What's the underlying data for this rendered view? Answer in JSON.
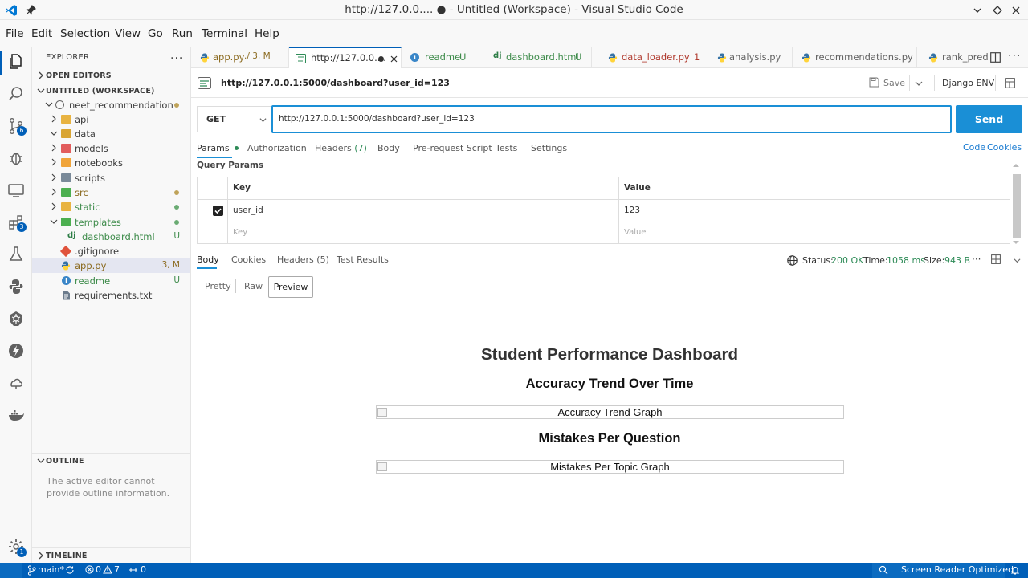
{
  "window": {
    "title": "http://127.0.0.... ● - Untitled (Workspace) - Visual Studio Code"
  },
  "menu": [
    "File",
    "Edit",
    "Selection",
    "View",
    "Go",
    "Run",
    "Terminal",
    "Help"
  ],
  "activity_badges": {
    "source_control": "6",
    "extensions": "3",
    "accounts": "1"
  },
  "sidebar": {
    "explorer_label": "EXPLORER",
    "open_editors": "OPEN EDITORS",
    "workspace": "UNTITLED (WORKSPACE)",
    "root": "neet_recommendation",
    "items": [
      {
        "label": "api",
        "status": ""
      },
      {
        "label": "data",
        "status": ""
      },
      {
        "label": "models",
        "status": ""
      },
      {
        "label": "notebooks",
        "status": ""
      },
      {
        "label": "scripts",
        "status": ""
      },
      {
        "label": "src",
        "status": "dot"
      },
      {
        "label": "static",
        "status": "dot"
      },
      {
        "label": "templates",
        "status": "dot"
      },
      {
        "label": "dashboard.html",
        "status": "U"
      },
      {
        "label": ".gitignore",
        "status": ""
      },
      {
        "label": "app.py",
        "status": "3, M"
      },
      {
        "label": "readme",
        "status": "U"
      },
      {
        "label": "requirements.txt",
        "status": ""
      }
    ],
    "outline_label": "OUTLINE",
    "outline_msg": "The active editor cannot provide outline information.",
    "timeline_label": "TIMELINE"
  },
  "tabs": [
    {
      "label": "app.py",
      "suffix": "./ 3, M"
    },
    {
      "label": "http://127.0.0....",
      "suffix": ""
    },
    {
      "label": "readme",
      "suffix": "U"
    },
    {
      "label": "dashboard.html",
      "suffix": "U"
    },
    {
      "label": "data_loader.py",
      "suffix": "1"
    },
    {
      "label": "analysis.py",
      "suffix": ""
    },
    {
      "label": "recommendations.py",
      "suffix": ""
    },
    {
      "label": "rank_predi",
      "suffix": ""
    }
  ],
  "request": {
    "title": "http://127.0.0.1:5000/dashboard?user_id=123",
    "save": "Save",
    "env": "Django ENV",
    "method": "GET",
    "url": "http://127.0.0.1:5000/dashboard?user_id=123",
    "send": "Send",
    "tabs": [
      "Params",
      "Authorization",
      "Headers",
      "Body",
      "Pre-request Script",
      "Tests",
      "Settings"
    ],
    "headers_count": "(7)",
    "code": "Code",
    "cookies": "Cookies",
    "query_params_label": "Query Params",
    "col_key": "Key",
    "col_value": "Value",
    "param_key": "user_id",
    "param_value": "123",
    "key_placeholder": "Key",
    "value_placeholder": "Value"
  },
  "response": {
    "tabs": [
      "Body",
      "Cookies",
      "Headers (5)",
      "Test Results"
    ],
    "status_label": "Status:",
    "status": "200 OK",
    "time_label": "Time:",
    "time": "1058 ms",
    "size_label": "Size:",
    "size": "943 B",
    "views": [
      "Pretty",
      "Raw",
      "Preview"
    ],
    "preview": {
      "h1": "Student Performance Dashboard",
      "h2a": "Accuracy Trend Over Time",
      "img_a": "Accuracy Trend Graph",
      "h2b": "Mistakes Per Question",
      "img_b": "Mistakes Per Topic Graph"
    }
  },
  "statusbar": {
    "branch": "main*",
    "errors": "0",
    "warnings": "7",
    "ports": "0",
    "screen_reader": "Screen Reader Optimized"
  },
  "colors": {
    "accent": "#005fb8",
    "send": "#1a8fd6",
    "ok": "#2e8b57"
  }
}
